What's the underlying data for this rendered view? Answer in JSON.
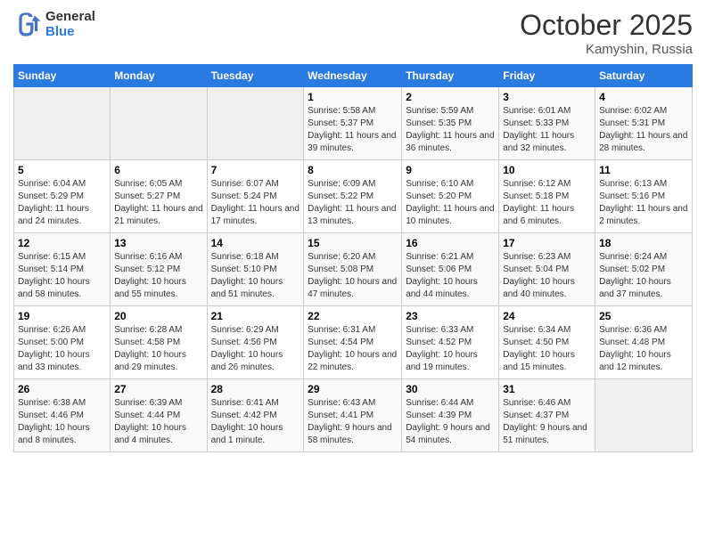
{
  "header": {
    "logo_general": "General",
    "logo_blue": "Blue",
    "month": "October 2025",
    "location": "Kamyshin, Russia"
  },
  "days_of_week": [
    "Sunday",
    "Monday",
    "Tuesday",
    "Wednesday",
    "Thursday",
    "Friday",
    "Saturday"
  ],
  "weeks": [
    [
      {
        "day": "",
        "info": ""
      },
      {
        "day": "",
        "info": ""
      },
      {
        "day": "",
        "info": ""
      },
      {
        "day": "1",
        "info": "Sunrise: 5:58 AM\nSunset: 5:37 PM\nDaylight: 11 hours and 39 minutes."
      },
      {
        "day": "2",
        "info": "Sunrise: 5:59 AM\nSunset: 5:35 PM\nDaylight: 11 hours and 36 minutes."
      },
      {
        "day": "3",
        "info": "Sunrise: 6:01 AM\nSunset: 5:33 PM\nDaylight: 11 hours and 32 minutes."
      },
      {
        "day": "4",
        "info": "Sunrise: 6:02 AM\nSunset: 5:31 PM\nDaylight: 11 hours and 28 minutes."
      }
    ],
    [
      {
        "day": "5",
        "info": "Sunrise: 6:04 AM\nSunset: 5:29 PM\nDaylight: 11 hours and 24 minutes."
      },
      {
        "day": "6",
        "info": "Sunrise: 6:05 AM\nSunset: 5:27 PM\nDaylight: 11 hours and 21 minutes."
      },
      {
        "day": "7",
        "info": "Sunrise: 6:07 AM\nSunset: 5:24 PM\nDaylight: 11 hours and 17 minutes."
      },
      {
        "day": "8",
        "info": "Sunrise: 6:09 AM\nSunset: 5:22 PM\nDaylight: 11 hours and 13 minutes."
      },
      {
        "day": "9",
        "info": "Sunrise: 6:10 AM\nSunset: 5:20 PM\nDaylight: 11 hours and 10 minutes."
      },
      {
        "day": "10",
        "info": "Sunrise: 6:12 AM\nSunset: 5:18 PM\nDaylight: 11 hours and 6 minutes."
      },
      {
        "day": "11",
        "info": "Sunrise: 6:13 AM\nSunset: 5:16 PM\nDaylight: 11 hours and 2 minutes."
      }
    ],
    [
      {
        "day": "12",
        "info": "Sunrise: 6:15 AM\nSunset: 5:14 PM\nDaylight: 10 hours and 58 minutes."
      },
      {
        "day": "13",
        "info": "Sunrise: 6:16 AM\nSunset: 5:12 PM\nDaylight: 10 hours and 55 minutes."
      },
      {
        "day": "14",
        "info": "Sunrise: 6:18 AM\nSunset: 5:10 PM\nDaylight: 10 hours and 51 minutes."
      },
      {
        "day": "15",
        "info": "Sunrise: 6:20 AM\nSunset: 5:08 PM\nDaylight: 10 hours and 47 minutes."
      },
      {
        "day": "16",
        "info": "Sunrise: 6:21 AM\nSunset: 5:06 PM\nDaylight: 10 hours and 44 minutes."
      },
      {
        "day": "17",
        "info": "Sunrise: 6:23 AM\nSunset: 5:04 PM\nDaylight: 10 hours and 40 minutes."
      },
      {
        "day": "18",
        "info": "Sunrise: 6:24 AM\nSunset: 5:02 PM\nDaylight: 10 hours and 37 minutes."
      }
    ],
    [
      {
        "day": "19",
        "info": "Sunrise: 6:26 AM\nSunset: 5:00 PM\nDaylight: 10 hours and 33 minutes."
      },
      {
        "day": "20",
        "info": "Sunrise: 6:28 AM\nSunset: 4:58 PM\nDaylight: 10 hours and 29 minutes."
      },
      {
        "day": "21",
        "info": "Sunrise: 6:29 AM\nSunset: 4:56 PM\nDaylight: 10 hours and 26 minutes."
      },
      {
        "day": "22",
        "info": "Sunrise: 6:31 AM\nSunset: 4:54 PM\nDaylight: 10 hours and 22 minutes."
      },
      {
        "day": "23",
        "info": "Sunrise: 6:33 AM\nSunset: 4:52 PM\nDaylight: 10 hours and 19 minutes."
      },
      {
        "day": "24",
        "info": "Sunrise: 6:34 AM\nSunset: 4:50 PM\nDaylight: 10 hours and 15 minutes."
      },
      {
        "day": "25",
        "info": "Sunrise: 6:36 AM\nSunset: 4:48 PM\nDaylight: 10 hours and 12 minutes."
      }
    ],
    [
      {
        "day": "26",
        "info": "Sunrise: 6:38 AM\nSunset: 4:46 PM\nDaylight: 10 hours and 8 minutes."
      },
      {
        "day": "27",
        "info": "Sunrise: 6:39 AM\nSunset: 4:44 PM\nDaylight: 10 hours and 4 minutes."
      },
      {
        "day": "28",
        "info": "Sunrise: 6:41 AM\nSunset: 4:42 PM\nDaylight: 10 hours and 1 minute."
      },
      {
        "day": "29",
        "info": "Sunrise: 6:43 AM\nSunset: 4:41 PM\nDaylight: 9 hours and 58 minutes."
      },
      {
        "day": "30",
        "info": "Sunrise: 6:44 AM\nSunset: 4:39 PM\nDaylight: 9 hours and 54 minutes."
      },
      {
        "day": "31",
        "info": "Sunrise: 6:46 AM\nSunset: 4:37 PM\nDaylight: 9 hours and 51 minutes."
      },
      {
        "day": "",
        "info": ""
      }
    ]
  ]
}
